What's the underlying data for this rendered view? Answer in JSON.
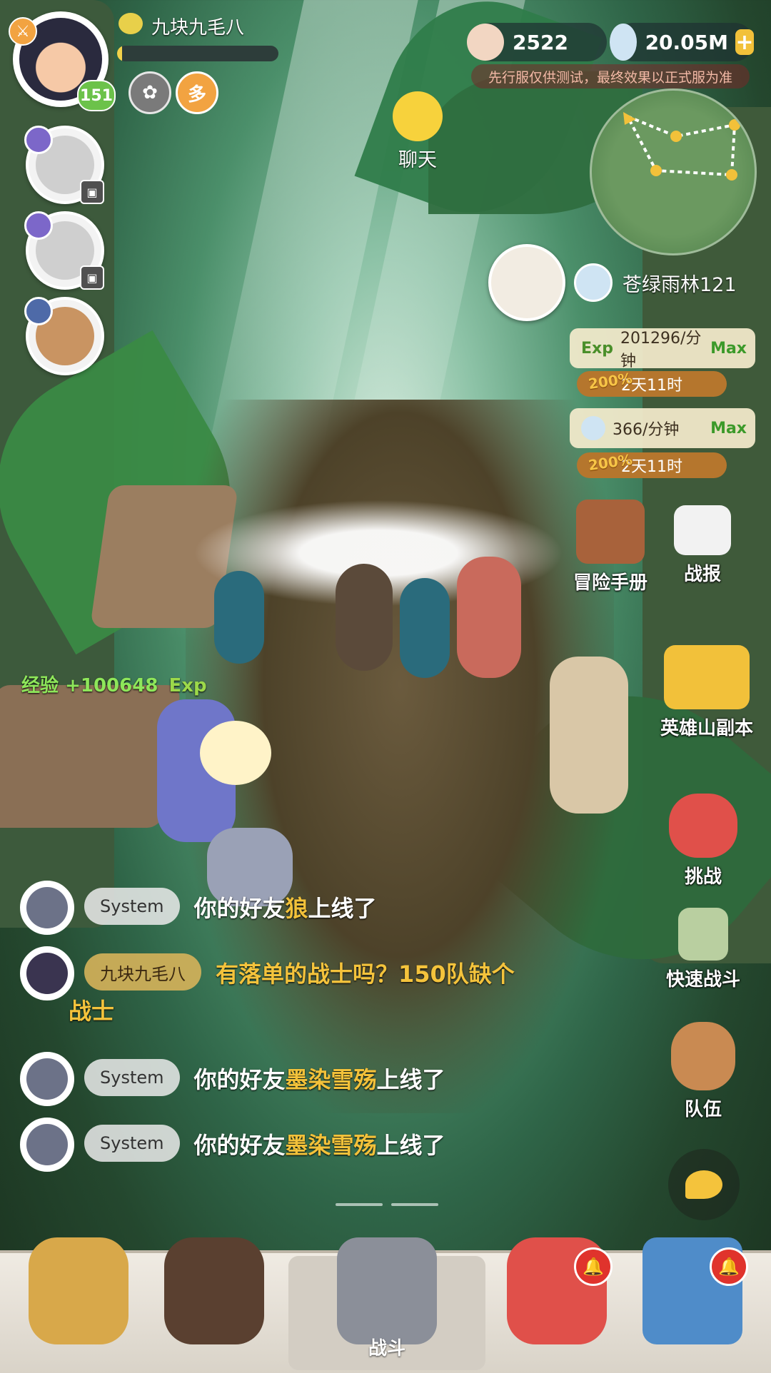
{
  "player": {
    "name": "九块九毛八",
    "level": "151",
    "xp_fraction": 0.03
  },
  "currencies": {
    "shells": "2522",
    "gems": "20.05M",
    "plus": "+"
  },
  "test_notice": "先行服仅供测试，最终效果以正式服为准",
  "chat_shortcut_label": "聊天",
  "area": {
    "name": "苍绿雨林121"
  },
  "rates": {
    "exp_label": "Exp",
    "exp_value": "201296/分钟",
    "exp_max": "Max",
    "exp_bonus": "200%",
    "exp_time": "2天11时",
    "gem_value": "366/分钟",
    "gem_max": "Max",
    "gem_bonus": "200%",
    "gem_time": "2天11时"
  },
  "side_buttons": {
    "manual": "冒险手册",
    "report": "战报",
    "hero_mountain": "英雄山副本",
    "challenge": "挑战",
    "quick_battle": "快速战斗",
    "team": "队伍"
  },
  "xp_gain": {
    "label": "经验",
    "value": "+100648",
    "unit": "Exp"
  },
  "chat": [
    {
      "sender": "System",
      "prefix": "你的好友",
      "highlight": "狼",
      "suffix": "上线了"
    },
    {
      "sender": "九块九毛八",
      "text": "有落单的战士吗？150队缺个",
      "text2": "战士"
    },
    {
      "sender": "System",
      "prefix": "你的好友",
      "highlight": "墨染雪殇",
      "suffix": "上线了"
    },
    {
      "sender": "System",
      "prefix": "你的好友",
      "highlight": "墨染雪殇",
      "suffix": "上线了"
    }
  ],
  "bottom_nav": {
    "battle_label": "战斗"
  },
  "colors": {
    "accent_gold": "#f2c13a",
    "level_green": "#6cc24a",
    "alert_red": "#e0332c"
  },
  "icons": [
    "sword-icon",
    "gem-icon",
    "shell-icon",
    "plus-icon",
    "chat-bubble-icon",
    "bell-alert-icon",
    "lock-icon"
  ]
}
